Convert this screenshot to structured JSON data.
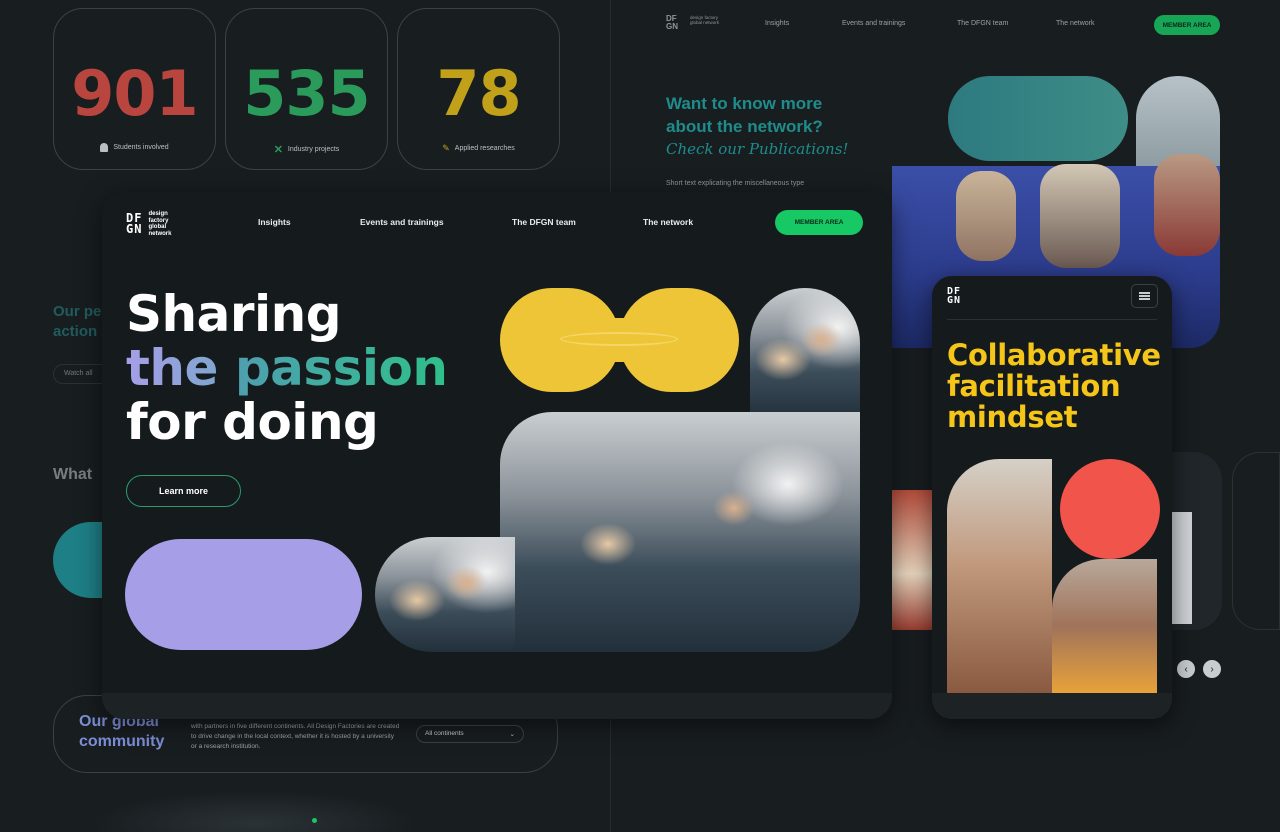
{
  "stats": [
    {
      "value": "901",
      "label": "Students involved",
      "color": "#b8463e",
      "icon": "student-icon"
    },
    {
      "value": "535",
      "label": "Industry projects",
      "color": "#2a9b5a",
      "icon": "cross-tools-icon"
    },
    {
      "value": "78",
      "label": "Applied researches",
      "color": "#c2a11a",
      "icon": "pencil-icon"
    }
  ],
  "left_bg": {
    "section_title": "Our pe\naction",
    "watch_btn": "Watch all",
    "what_heading": "What",
    "community_title": "Our global community",
    "community_text": "with partners in five different continents. All Design Factories are created to drive change in the local context, whether it is hosted by a university or a research institution.",
    "continent_select": "All continents"
  },
  "right_bg": {
    "nav": [
      "Insights",
      "Events and trainings",
      "The DFGN team",
      "The network"
    ],
    "member_btn": "MEMBER AREA",
    "heading_line1": "Want to know more",
    "heading_line2": "about the network?",
    "heading_italic": "Check our Publications!",
    "short_text": "Short text explicating the miscellaneous type"
  },
  "desktop": {
    "logo_letters": "DF\nGN",
    "logo_text": "design factory global network",
    "nav": [
      "Insights",
      "Events and trainings",
      "The DFGN team",
      "The network"
    ],
    "member_btn": "MEMBER AREA",
    "hero_line1": "Sharing",
    "hero_line2_a": "the",
    "hero_line2_b": "passion",
    "hero_line3": "for doing",
    "learn_more": "Learn more"
  },
  "mobile": {
    "logo_letters": "DF\nGN",
    "heading_line1": "Collaborative",
    "heading_line2": "facilitation",
    "heading_line3": "mindset"
  },
  "colors": {
    "accent_green": "#17c964",
    "hero_yellow": "#f5c518",
    "lavender": "#a79ee8",
    "coral": "#f0544a",
    "teal": "#2a8f8f"
  }
}
